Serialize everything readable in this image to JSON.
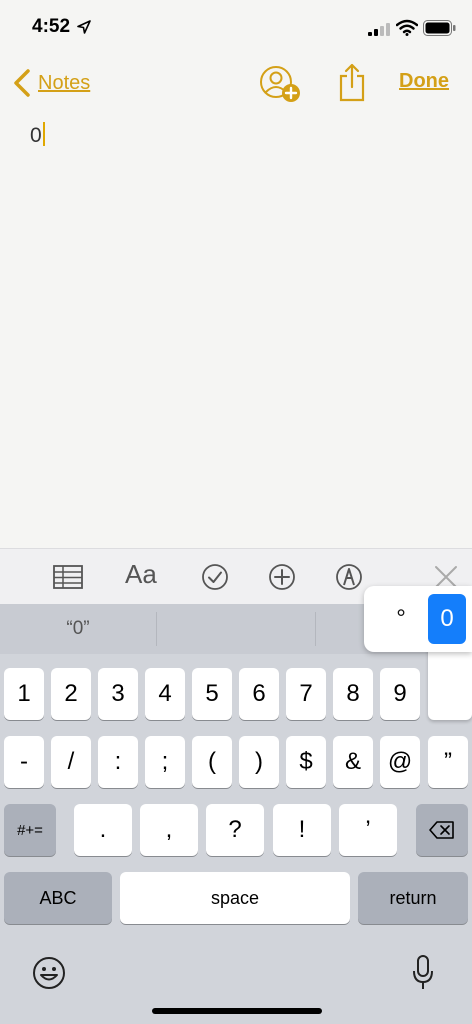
{
  "status": {
    "time": "4:52"
  },
  "nav": {
    "back_label": "Notes",
    "done_label": "Done"
  },
  "note": {
    "text": "0"
  },
  "toolbar": {
    "format_label": "Aa"
  },
  "predictive": {
    "suggestion": "“0”"
  },
  "keyboard": {
    "row1": [
      "1",
      "2",
      "3",
      "4",
      "5",
      "6",
      "7",
      "8",
      "9"
    ],
    "row2": [
      "-",
      "/",
      ":",
      ";",
      "(",
      ")",
      "$",
      "&",
      "@",
      "”"
    ],
    "row3": [
      ".",
      ",",
      "?",
      "!",
      "’"
    ],
    "more_symbols": "#+=",
    "abc": "ABC",
    "space": "space",
    "return": "return"
  },
  "accent_popup": {
    "options": [
      "°",
      "0"
    ],
    "selected": "0"
  },
  "colors": {
    "accent": "#d4a017",
    "selected_key": "#147efb"
  }
}
